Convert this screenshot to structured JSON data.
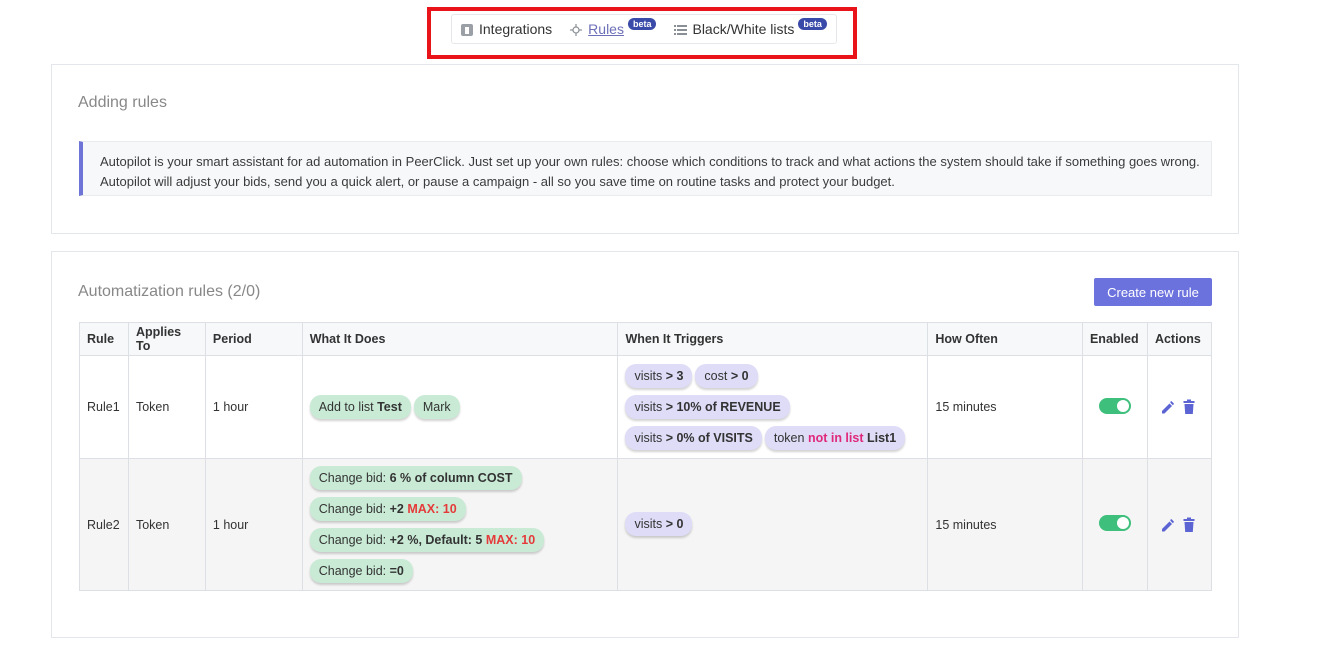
{
  "nav": {
    "items": [
      {
        "label": "Integrations",
        "icon": "integrations-icon",
        "active": false,
        "badge": ""
      },
      {
        "label": "Rules",
        "icon": "rules-crosshair-icon",
        "active": true,
        "badge": "beta"
      },
      {
        "label": "Black/White lists",
        "icon": "list-icon",
        "active": false,
        "badge": "beta"
      }
    ],
    "highlight_color": "#e8141a"
  },
  "adding_rules": {
    "title": "Adding rules",
    "info_line1": "Autopilot is your smart assistant for ad automation in PeerClick. Just set up your own rules: choose which conditions to track and what actions the system should take if something goes wrong.",
    "info_line2": "Autopilot will adjust your bids, send you a quick alert, or pause a campaign - all so you save time on routine tasks and protect your budget."
  },
  "automatization": {
    "title": "Automatization rules (2/0)",
    "create_button": "Create new rule",
    "columns": [
      "Rule",
      "Applies To",
      "Period",
      "What It Does",
      "When It Triggers",
      "How Often",
      "Enabled",
      "Actions"
    ],
    "rows": [
      {
        "rule": "Rule1",
        "applies_to": "Token",
        "period": "1 hour",
        "how_often": "15 minutes",
        "enabled": true,
        "does": [
          {
            "a": "Add to list ",
            "b": "Test"
          },
          {
            "a": "Mark"
          }
        ],
        "triggers": [
          [
            {
              "a": "visits ",
              "b": "> 3"
            },
            {
              "a": "cost ",
              "b": "> 0"
            }
          ],
          [
            {
              "a": "visits ",
              "b": "> 10% of REVENUE"
            }
          ],
          [
            {
              "a": "visits ",
              "b": "> 0% of VISITS"
            },
            {
              "a": "token ",
              "p": "not in list",
              "b": "List1"
            }
          ]
        ]
      },
      {
        "rule": "Rule2",
        "applies_to": "Token",
        "period": "1 hour",
        "how_often": "15 minutes",
        "enabled": true,
        "does": [
          {
            "a": "Change bid: ",
            "b": "6 % of column COST"
          },
          {
            "a": "Change bid: ",
            "b": "+2",
            "r": "MAX: 10"
          },
          {
            "a": "Change bid: ",
            "b": "+2 %, Default: 5",
            "r": "MAX: 10"
          },
          {
            "a": "Change bid: ",
            "b": "=0"
          }
        ],
        "triggers": [
          [
            {
              "a": "visits ",
              "b": "> 0"
            }
          ]
        ]
      }
    ]
  },
  "colors": {
    "accent": "#6c72dd",
    "chip_green": "#c9ebd6",
    "chip_purple": "#dedcf7",
    "toggle_on": "#3ebf7c",
    "danger_text": "#e53a3a",
    "pink_text": "#e0287a"
  }
}
